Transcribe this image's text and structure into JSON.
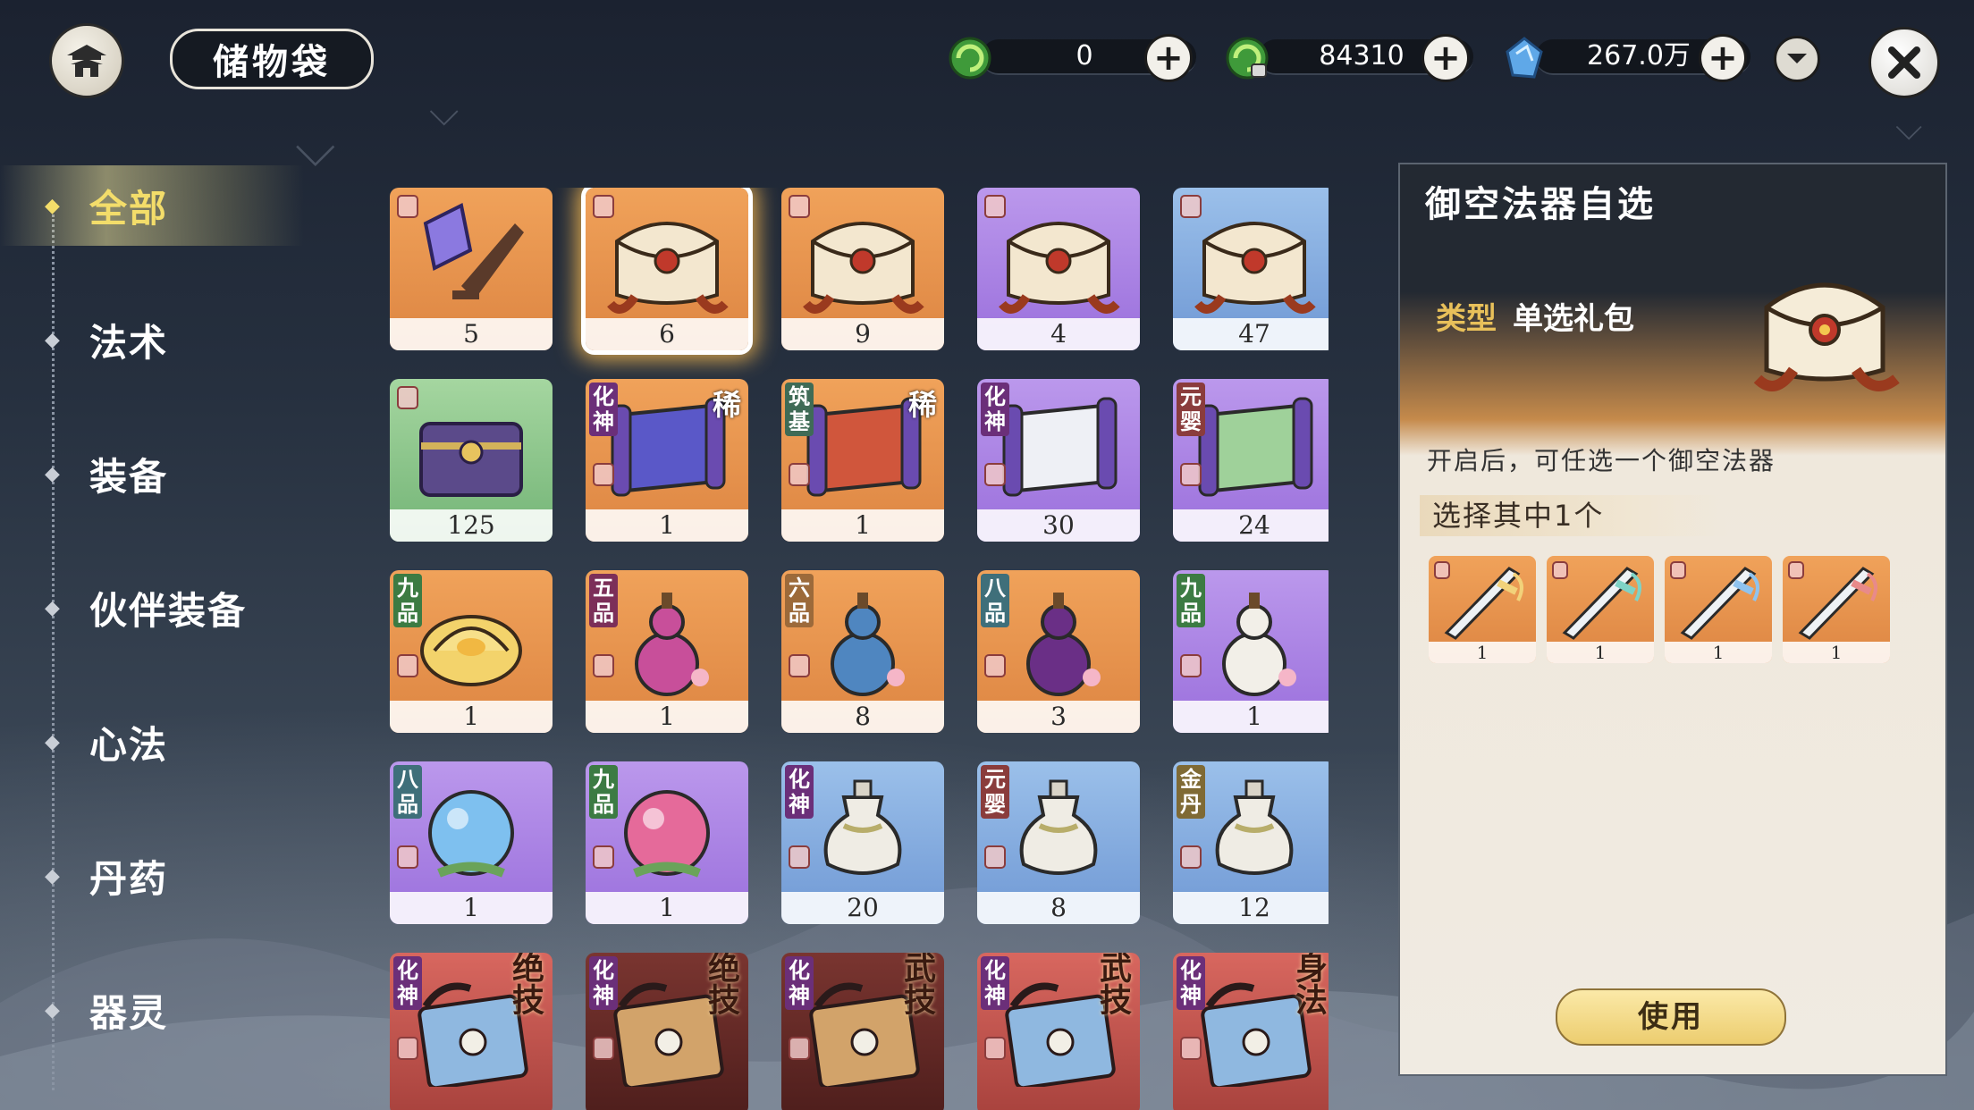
{
  "header": {
    "title": "储物袋",
    "currencies": [
      {
        "icon": "green-swirl-icon",
        "value": "0"
      },
      {
        "icon": "green-swirl-lock-icon",
        "value": "84310"
      },
      {
        "icon": "blue-spirit-stone-icon",
        "value": "267.0万"
      }
    ]
  },
  "sidebar": {
    "categories": [
      {
        "label": "全部",
        "active": true
      },
      {
        "label": "法术",
        "active": false
      },
      {
        "label": "装备",
        "active": false
      },
      {
        "label": "伙伴装备",
        "active": false
      },
      {
        "label": "心法",
        "active": false
      },
      {
        "label": "丹药",
        "active": false
      },
      {
        "label": "器灵",
        "active": false
      }
    ]
  },
  "inventory": [
    {
      "icon": "broken-sword-shard-icon",
      "bg": "orange",
      "count": "5",
      "tag": "",
      "extra": ""
    },
    {
      "icon": "gift-chest-icon",
      "bg": "orange",
      "count": "6",
      "tag": "",
      "extra": "",
      "selected": true
    },
    {
      "icon": "gift-chest-icon",
      "bg": "orange",
      "count": "9",
      "tag": "",
      "extra": ""
    },
    {
      "icon": "gift-chest-icon",
      "bg": "purple",
      "count": "4",
      "tag": "",
      "extra": ""
    },
    {
      "icon": "gift-chest-icon",
      "bg": "blue",
      "count": "47",
      "tag": "",
      "extra": ""
    },
    {
      "icon": "treasure-chest-icon",
      "bg": "green",
      "count": "125",
      "tag": "",
      "extra": ""
    },
    {
      "icon": "banner-scroll-icon",
      "bg": "orange",
      "count": "1",
      "tag": "化神",
      "extra": "稀"
    },
    {
      "icon": "red-scroll-icon",
      "bg": "orange",
      "count": "1",
      "tag": "筑基",
      "extra": "稀"
    },
    {
      "icon": "paper-scroll-icon",
      "bg": "purple",
      "count": "30",
      "tag": "化神",
      "extra": ""
    },
    {
      "icon": "green-scroll-icon",
      "bg": "purple",
      "count": "24",
      "tag": "元婴",
      "extra": ""
    },
    {
      "icon": "golden-lotus-icon",
      "bg": "orange",
      "count": "1",
      "tag": "九品",
      "extra": ""
    },
    {
      "icon": "pink-gourd-icon",
      "bg": "orange",
      "count": "1",
      "tag": "五品",
      "extra": ""
    },
    {
      "icon": "blue-gourd-icon",
      "bg": "orange",
      "count": "8",
      "tag": "六品",
      "extra": ""
    },
    {
      "icon": "purple-flask-icon",
      "bg": "orange",
      "count": "3",
      "tag": "八品",
      "extra": ""
    },
    {
      "icon": "white-flask-icon",
      "bg": "purple",
      "count": "1",
      "tag": "九品",
      "extra": ""
    },
    {
      "icon": "blue-orb-icon",
      "bg": "purple",
      "count": "1",
      "tag": "八品",
      "extra": ""
    },
    {
      "icon": "pink-orb-icon",
      "bg": "purple",
      "count": "1",
      "tag": "九品",
      "extra": ""
    },
    {
      "icon": "porcelain-jar-icon",
      "bg": "blue",
      "count": "20",
      "tag": "化神",
      "extra": ""
    },
    {
      "icon": "porcelain-jar-icon",
      "bg": "blue",
      "count": "8",
      "tag": "元婴",
      "extra": ""
    },
    {
      "icon": "porcelain-jar-icon",
      "bg": "blue",
      "count": "12",
      "tag": "金丹",
      "extra": ""
    },
    {
      "icon": "skill-book-icon",
      "bg": "red",
      "count": "",
      "tag": "化神",
      "extra": "绝技"
    },
    {
      "icon": "locked-book-icon",
      "bg": "dark",
      "count": "",
      "tag": "化神",
      "extra": "绝技"
    },
    {
      "icon": "locked-book-icon",
      "bg": "dark",
      "count": "",
      "tag": "化神",
      "extra": "武技"
    },
    {
      "icon": "skill-book-icon",
      "bg": "red",
      "count": "",
      "tag": "化神",
      "extra": "武技"
    },
    {
      "icon": "skill-book-icon",
      "bg": "red",
      "count": "",
      "tag": "化神",
      "extra": "身法"
    }
  ],
  "detail": {
    "title": "御空法器自选",
    "type_key": "类型",
    "type_value": "单选礼包",
    "description": "开启后，可任选一个御空法器",
    "choose_label": "选择其中1个",
    "options": [
      {
        "icon": "golden-sword-icon",
        "count": "1",
        "color": "#f2d27a"
      },
      {
        "icon": "jade-sword-icon",
        "count": "1",
        "color": "#7fd3c6"
      },
      {
        "icon": "azure-sword-icon",
        "count": "1",
        "color": "#8fc3ef"
      },
      {
        "icon": "crimson-sword-icon",
        "count": "1",
        "color": "#e88a8a"
      }
    ],
    "use_label": "使用"
  },
  "colors": {
    "accent_gold": "#f3dd6a",
    "orange_bg": "#e89450",
    "purple_bg": "#a87ee2",
    "blue_bg": "#86abe0",
    "green_bg": "#8cc58b",
    "red_bg": "#c0544d"
  }
}
